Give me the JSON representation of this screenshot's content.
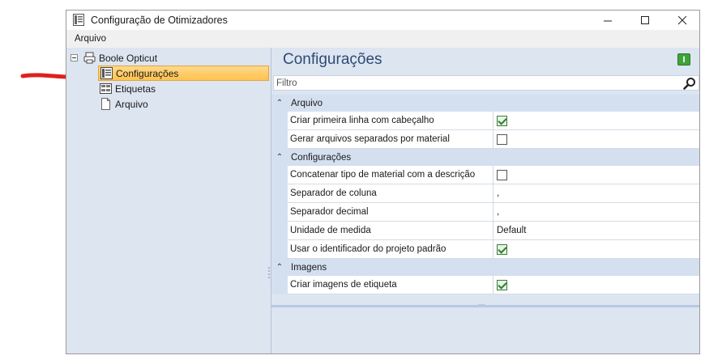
{
  "window": {
    "title": "Configuração de Otimizadores",
    "controls": {
      "minimize": "—",
      "maximize": "☐",
      "close": "✕"
    }
  },
  "menu": {
    "items": [
      {
        "label": "Arquivo"
      }
    ]
  },
  "tree": {
    "root": {
      "label": "Boole Opticut",
      "expanded": true
    },
    "children": [
      {
        "label": "Configurações",
        "selected": true,
        "icon": "config-icon"
      },
      {
        "label": "Etiquetas",
        "selected": false,
        "icon": "labels-icon"
      },
      {
        "label": "Arquivo",
        "selected": false,
        "icon": "file-icon"
      }
    ]
  },
  "panel": {
    "title": "Configurações",
    "action_button": "I",
    "filter_placeholder": "Filtro"
  },
  "properties": {
    "categories": [
      {
        "label": "Arquivo",
        "items": [
          {
            "name": "Criar primeira linha com cabeçalho",
            "type": "checkbox",
            "checked": true
          },
          {
            "name": "Gerar arquivos separados por material",
            "type": "checkbox",
            "checked": false
          }
        ]
      },
      {
        "label": "Configurações",
        "items": [
          {
            "name": "Concatenar tipo de material com a descrição",
            "type": "checkbox",
            "checked": false
          },
          {
            "name": "Separador de coluna",
            "type": "text",
            "value": ","
          },
          {
            "name": "Separador decimal",
            "type": "text",
            "value": ","
          },
          {
            "name": "Unidade de medida",
            "type": "text",
            "value": "Default"
          },
          {
            "name": "Usar o identificador do projeto padrão",
            "type": "checkbox",
            "checked": true
          }
        ]
      },
      {
        "label": "Imagens",
        "items": [
          {
            "name": "Criar imagens de etiqueta",
            "type": "checkbox",
            "checked": true
          }
        ]
      }
    ]
  },
  "colors": {
    "pane_background": "#dde5f1",
    "selection": "#ffc24e",
    "arrow": "#e0201b",
    "title": "#2f4a73"
  }
}
